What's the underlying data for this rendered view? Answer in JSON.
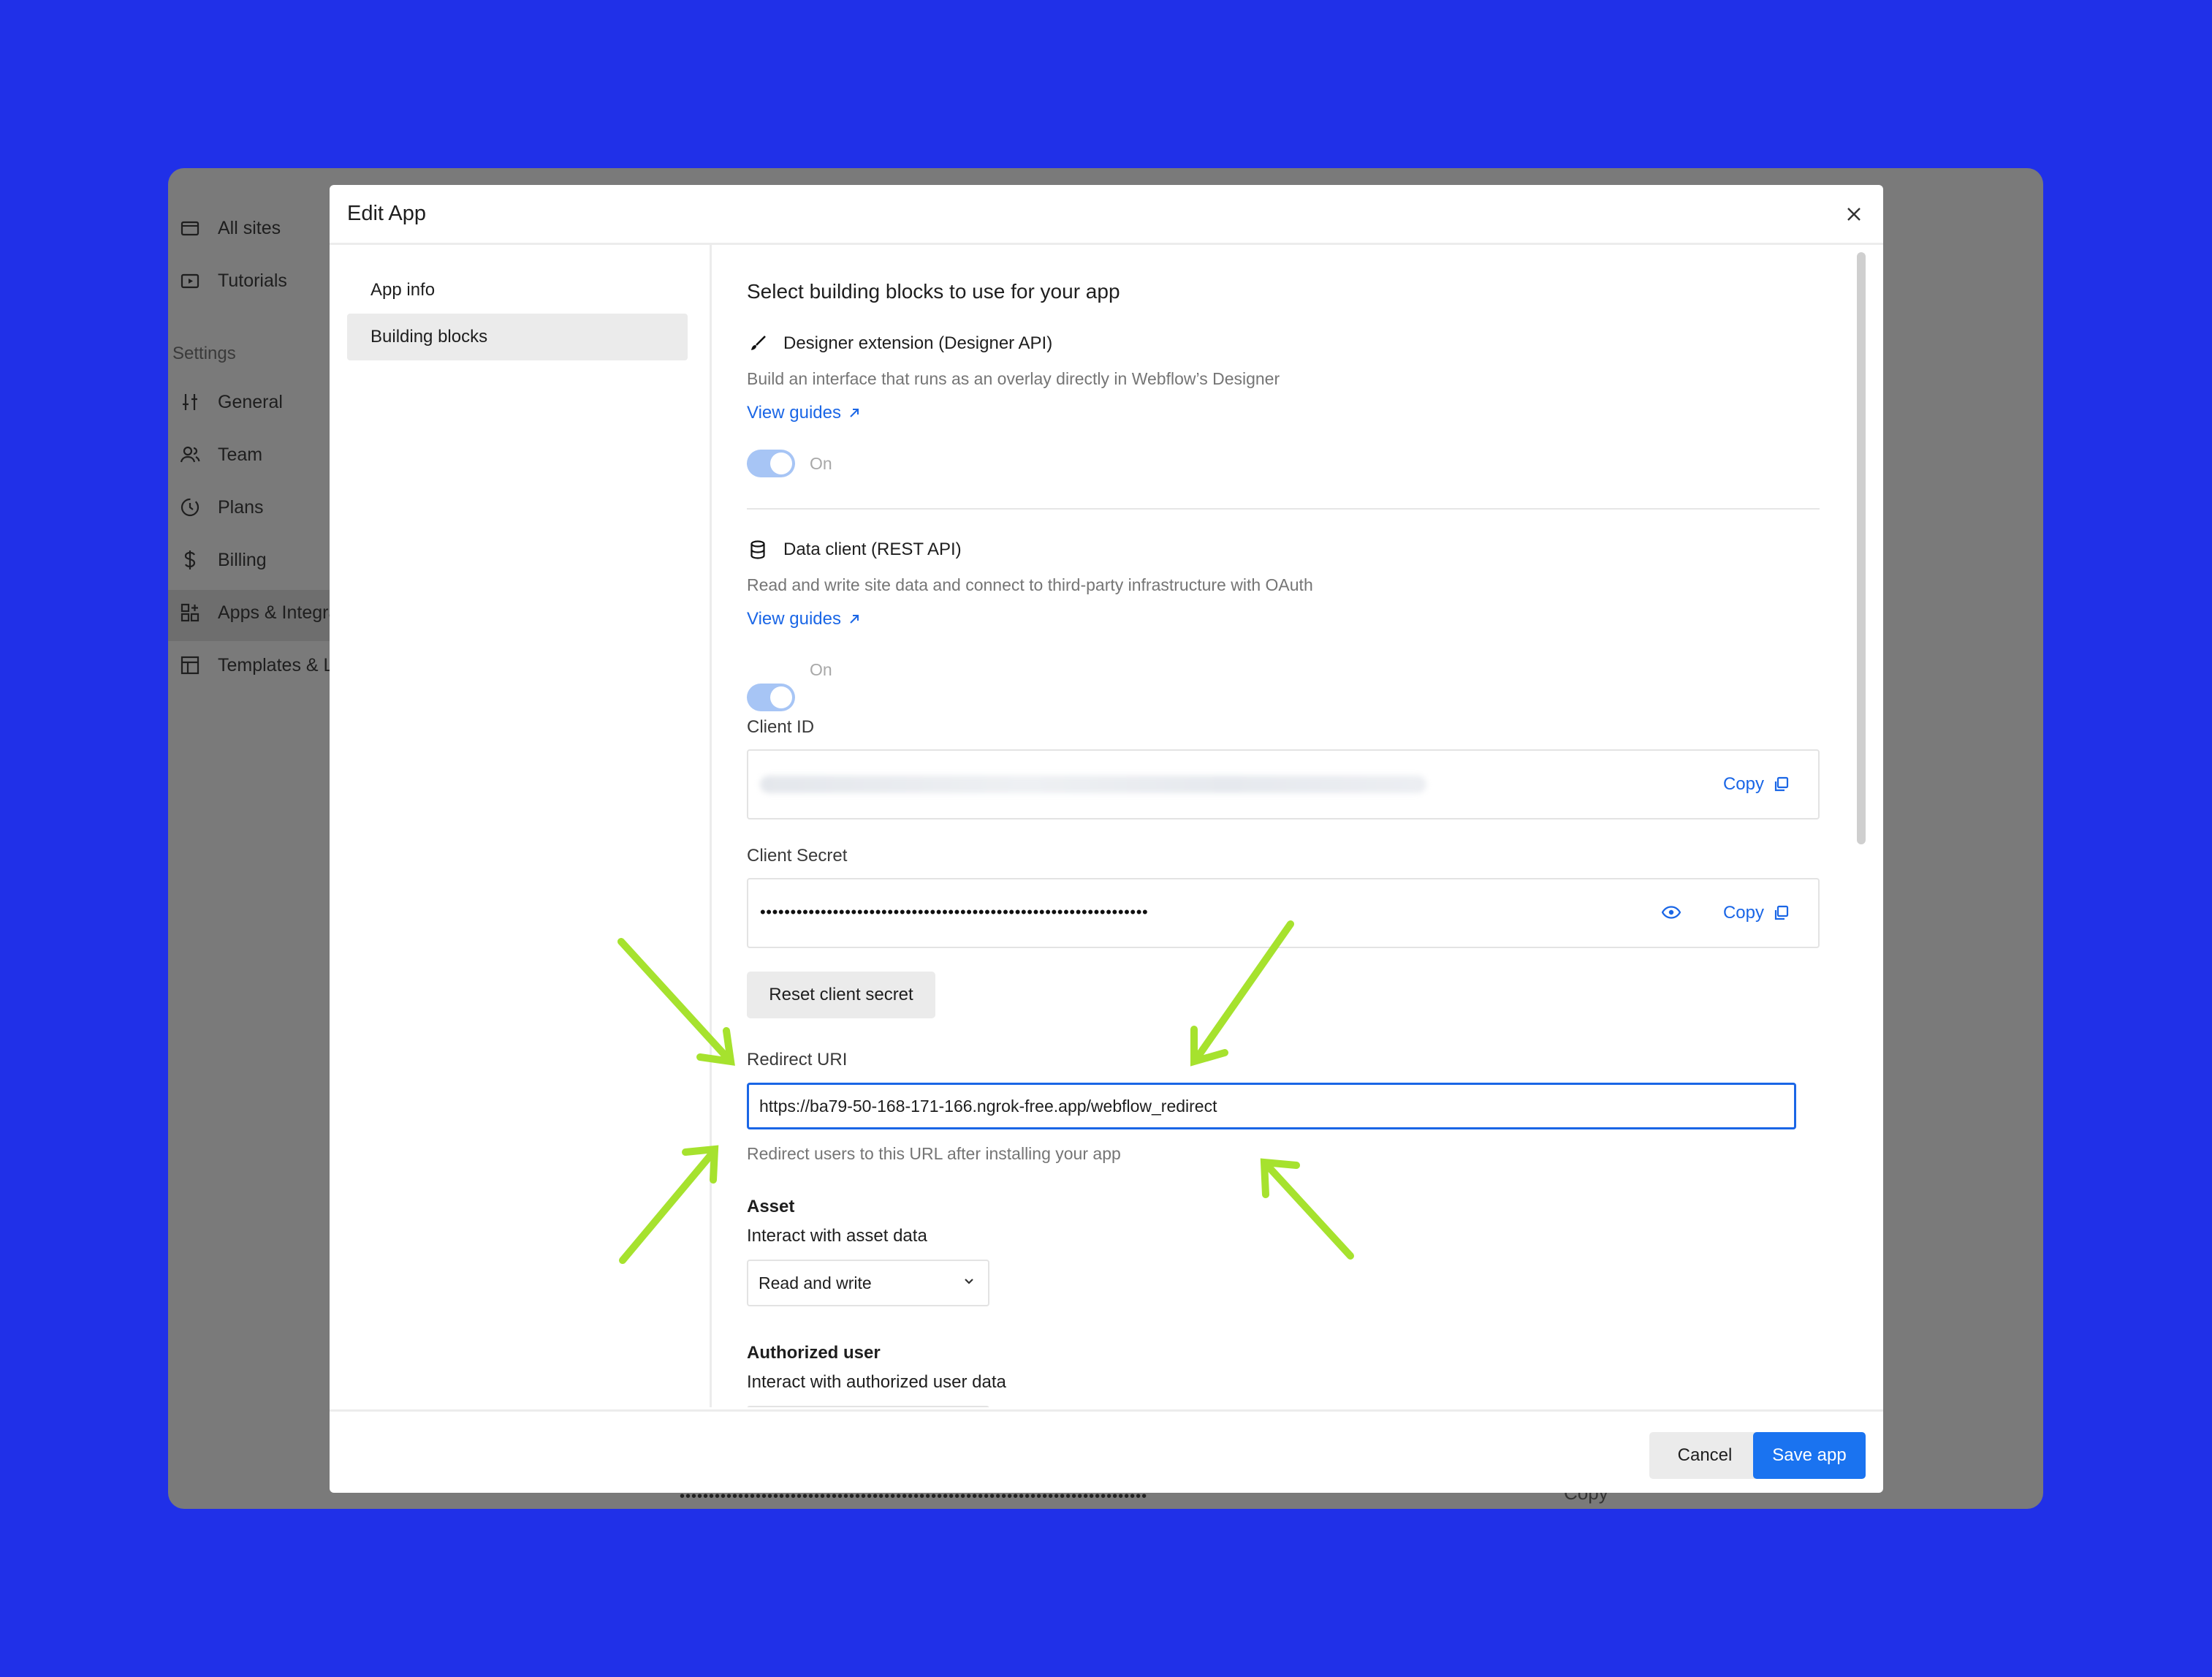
{
  "background_sidebar": {
    "items": [
      {
        "label": "All sites",
        "icon": "folder-icon"
      },
      {
        "label": "Tutorials",
        "icon": "tutorial-icon"
      }
    ],
    "settings_heading": "Settings",
    "settings_items": [
      {
        "label": "General",
        "icon": "sliders-icon"
      },
      {
        "label": "Team",
        "icon": "team-icon"
      },
      {
        "label": "Plans",
        "icon": "plans-icon"
      },
      {
        "label": "Billing",
        "icon": "dollar-icon"
      },
      {
        "label": "Apps & Integra",
        "icon": "apps-icon"
      },
      {
        "label": "Templates & L",
        "icon": "templates-icon"
      }
    ],
    "bottom_copy": "Copy"
  },
  "modal": {
    "title": "Edit App",
    "nav": [
      {
        "label": "App info",
        "active": false
      },
      {
        "label": "Building blocks",
        "active": true
      }
    ],
    "section_title": "Select building blocks to use for your app",
    "designer_extension": {
      "title": "Designer extension (Designer API)",
      "description": "Build an interface that runs as an overlay directly in Webflow’s Designer",
      "link": "View guides",
      "toggle_label": "On",
      "enabled": true
    },
    "data_client": {
      "title": "Data client (REST API)",
      "description": "Read and write site data and connect to third-party infrastructure with OAuth",
      "link": "View guides",
      "toggle_label": "On",
      "enabled": true
    },
    "client_id": {
      "label": "Client ID",
      "copy_label": "Copy"
    },
    "client_secret": {
      "label": "Client Secret",
      "masked_value": "••••••••••••••••••••••••••••••••••••••••••••••••••••••••••••••••",
      "copy_label": "Copy"
    },
    "reset_button": "Reset client secret",
    "redirect_uri": {
      "label": "Redirect URI",
      "value": "https://ba79-50-168-171-166.ngrok-free.app/webflow_redirect",
      "help": "Redirect users to this URL after installing your app"
    },
    "asset": {
      "title": "Asset",
      "subtitle": "Interact with asset data",
      "selected": "Read and write"
    },
    "authorized_user": {
      "title": "Authorized user",
      "subtitle": "Interact with authorized user data"
    },
    "footer": {
      "cancel": "Cancel",
      "save": "Save app"
    }
  },
  "colors": {
    "page_background": "#2030e8",
    "primary": "#1a73f0",
    "link": "#1a66e6",
    "annotation_arrow": "#a6e22e"
  }
}
